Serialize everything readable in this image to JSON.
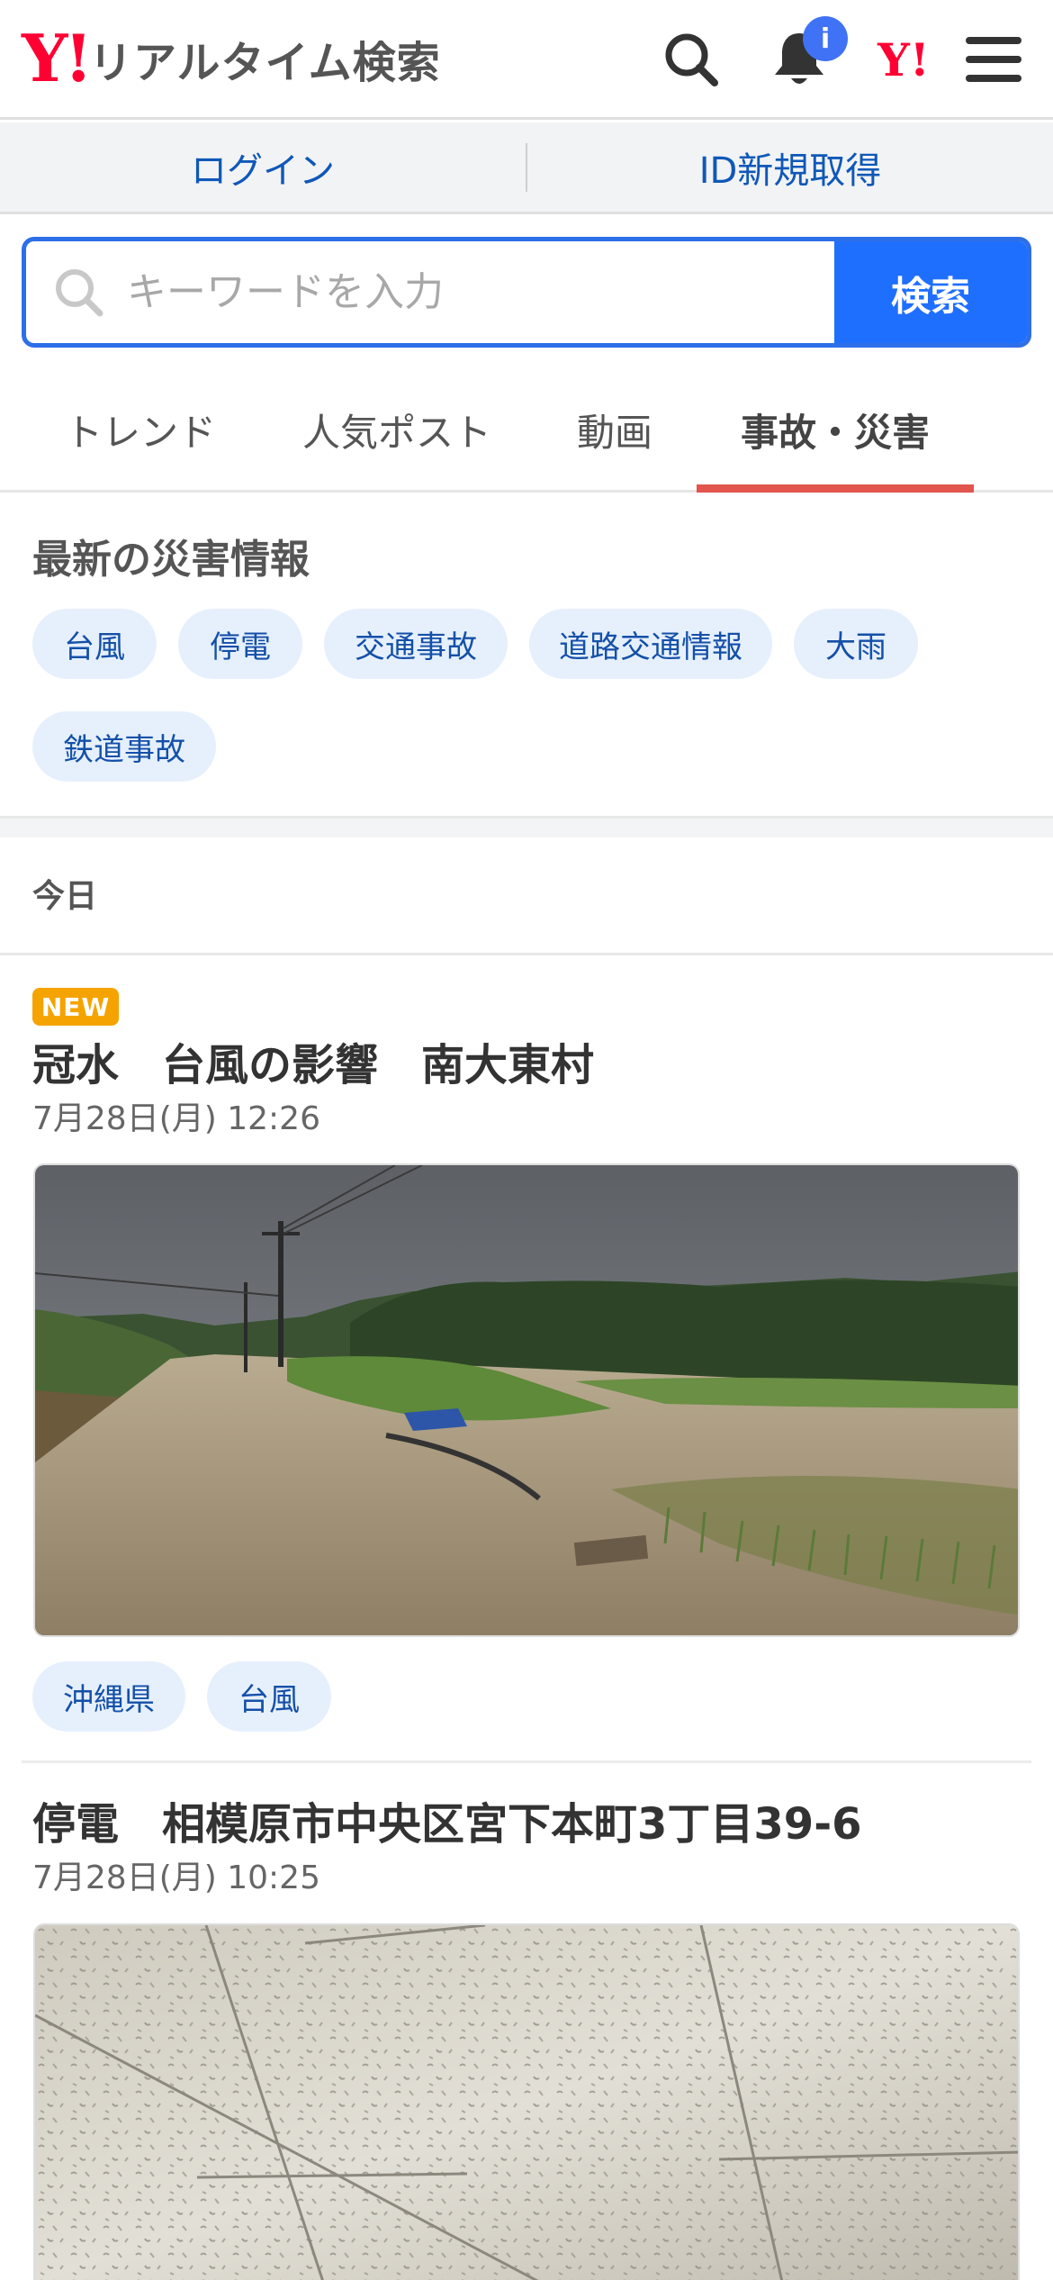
{
  "header": {
    "logo_mark": "Y!",
    "title": "リアルタイム検索",
    "notification_badge": "i",
    "yahoo_mark": "Y!"
  },
  "account": {
    "login": "ログイン",
    "register": "ID新規取得"
  },
  "search": {
    "placeholder": "キーワードを入力",
    "button": "検索"
  },
  "tabs": [
    {
      "label": "トレンド",
      "active": false
    },
    {
      "label": "人気ポスト",
      "active": false
    },
    {
      "label": "動画",
      "active": false
    },
    {
      "label": "事故・災害",
      "active": true
    }
  ],
  "disaster": {
    "title": "最新の災害情報",
    "chips": [
      "台風",
      "停電",
      "交通事故",
      "道路交通情報",
      "大雨",
      "鉄道事故"
    ]
  },
  "feed": {
    "section_label": "今日",
    "posts": [
      {
        "badge": "NEW",
        "title": "冠水　台風の影響　南大東村",
        "date": "7月28日(月) 12:26",
        "tags": [
          "沖縄県",
          "台風"
        ]
      },
      {
        "title": "停電　相模原市中央区宮下本町3丁目39-6",
        "date": "7月28日(月) 10:25"
      }
    ]
  },
  "colors": {
    "brand_red": "#ff0033",
    "link_blue": "#0f58b8",
    "search_blue": "#1f6fff",
    "tab_underline": "#e2554d",
    "new_badge": "#f5a300"
  }
}
